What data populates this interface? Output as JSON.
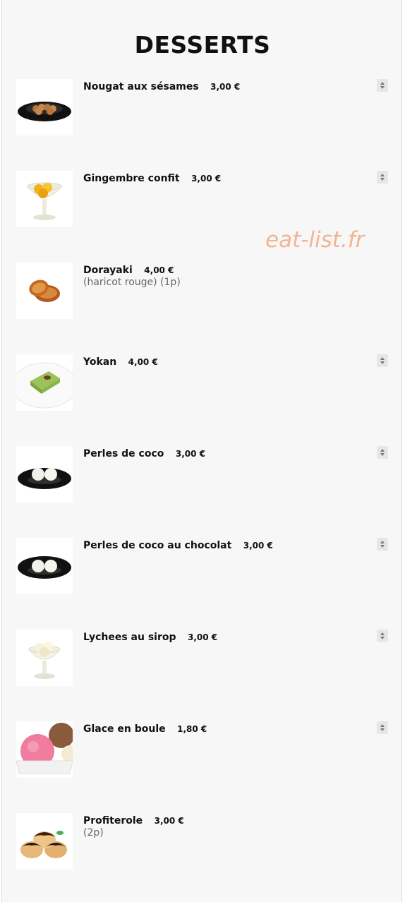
{
  "page": {
    "title": "DESSERTS",
    "watermark": "eat-list.fr"
  },
  "items": [
    {
      "name": "Nougat aux sésames",
      "price": "3,00 €",
      "desc": "",
      "stepper": true
    },
    {
      "name": "Gingembre confit",
      "price": "3,00 €",
      "desc": "",
      "stepper": true
    },
    {
      "name": "Dorayaki",
      "price": "4,00 €",
      "desc": "(haricot rouge) (1p)",
      "stepper": false
    },
    {
      "name": "Yokan",
      "price": "4,00 €",
      "desc": "",
      "stepper": true
    },
    {
      "name": "Perles de coco",
      "price": "3,00 €",
      "desc": "",
      "stepper": true
    },
    {
      "name": "Perles de coco au chocolat",
      "price": "3,00 €",
      "desc": "",
      "stepper": true
    },
    {
      "name": "Lychees au sirop",
      "price": "3,00 €",
      "desc": "",
      "stepper": true
    },
    {
      "name": "Glace en boule",
      "price": "1,80 €",
      "desc": "",
      "stepper": true
    },
    {
      "name": "Profiterole",
      "price": "3,00 €",
      "desc": "(2p)",
      "stepper": false
    }
  ]
}
